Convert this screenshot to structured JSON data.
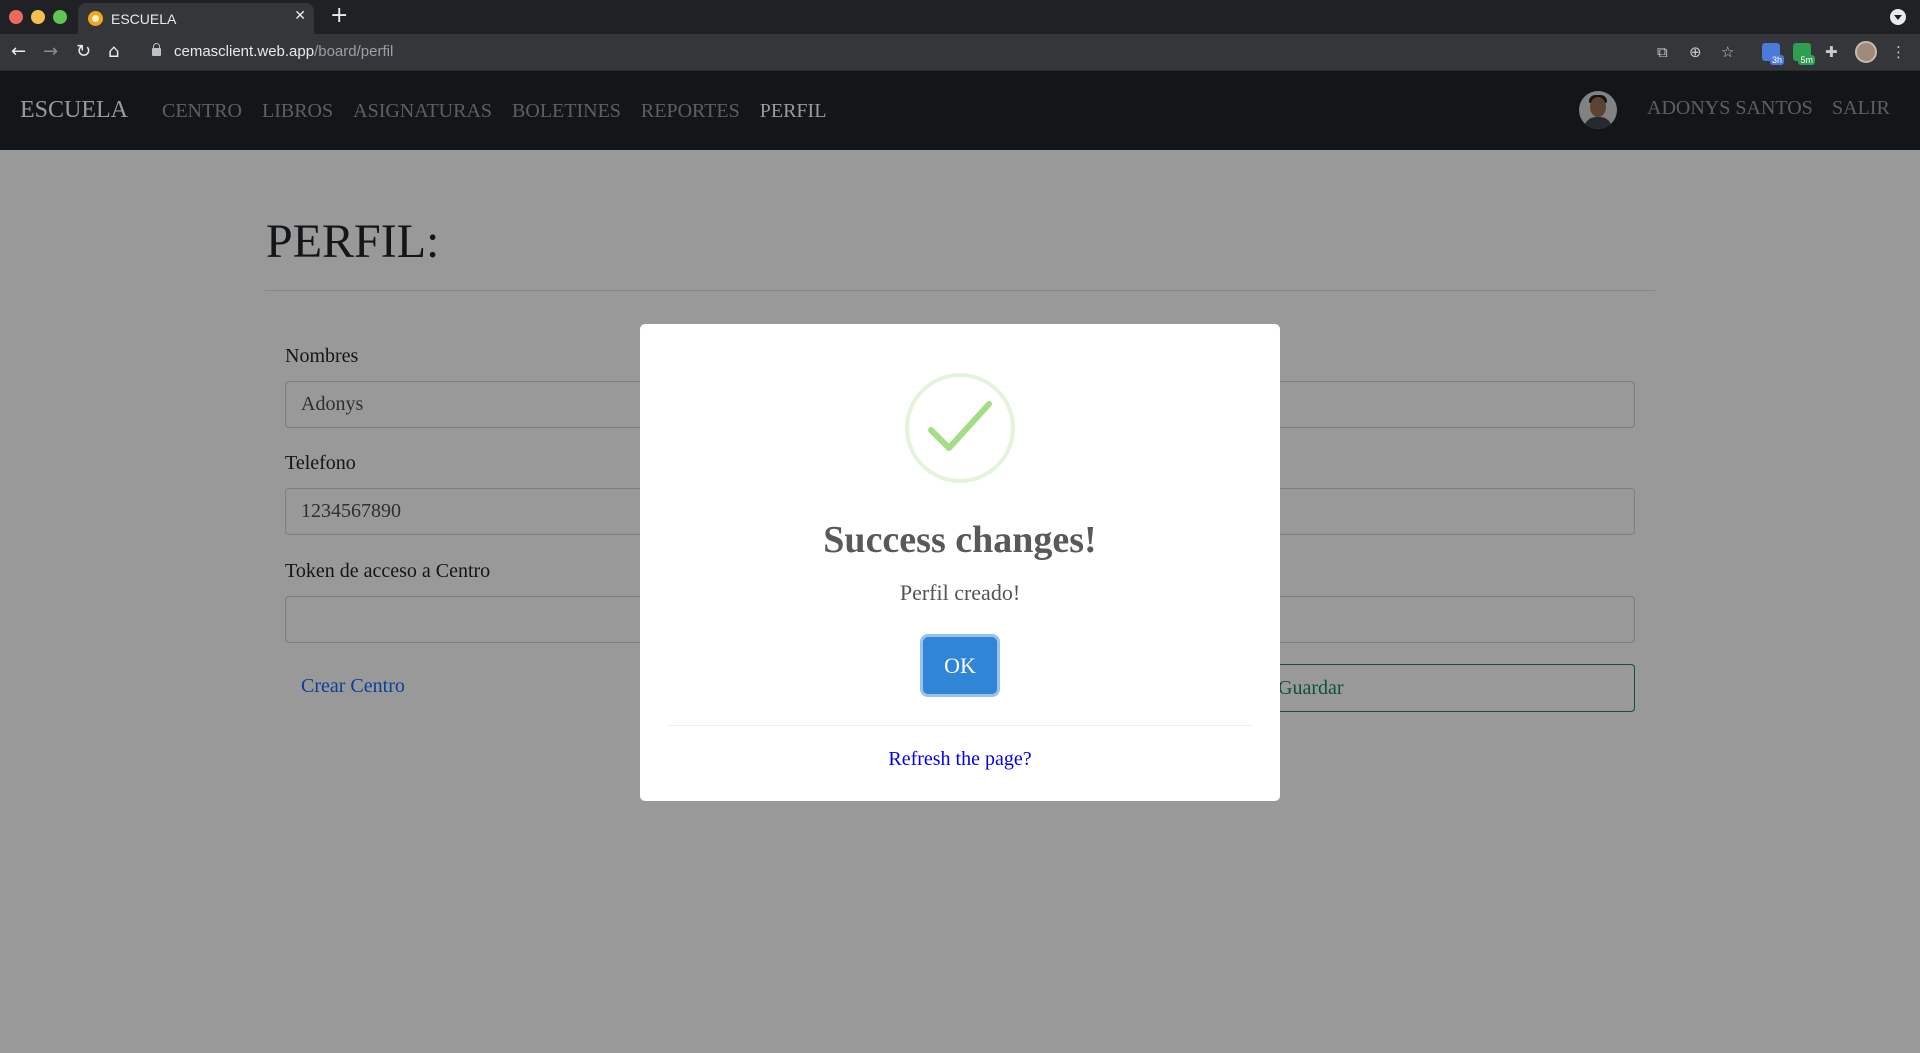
{
  "browser": {
    "tab_title": "ESCUELA",
    "tab_close": "✕",
    "new_tab": "+",
    "url_host": "cemasclient.web.app",
    "url_path": "/board/perfil",
    "ext_badge_1": "3h",
    "ext_badge_2": "5m"
  },
  "navbar": {
    "brand": "ESCUELA",
    "links": [
      "CENTRO",
      "LIBROS",
      "ASIGNATURAS",
      "BOLETINES",
      "REPORTES",
      "PERFIL"
    ],
    "active_link": "PERFIL",
    "user_name": "ADONYS SANTOS",
    "logout": "SALIR"
  },
  "page": {
    "title": "PERFIL:"
  },
  "form": {
    "nombres_label": "Nombres",
    "nombres_value": "Adonys",
    "telefono_label": "Telefono",
    "telefono_value": "1234567890",
    "token_label": "Token de acceso a Centro",
    "token_value": "",
    "crear_centro": "Crear Centro",
    "guardar": "Guardar"
  },
  "modal": {
    "title": "Success changes!",
    "text": "Perfil creado!",
    "ok_label": "OK",
    "footer_link": "Refresh the page?"
  },
  "colors": {
    "navbar_bg": "#212529",
    "ok_button": "#3085d6",
    "success_green": "#a5dc86",
    "save_green": "#198754",
    "link_blue": "#0d6efd"
  }
}
